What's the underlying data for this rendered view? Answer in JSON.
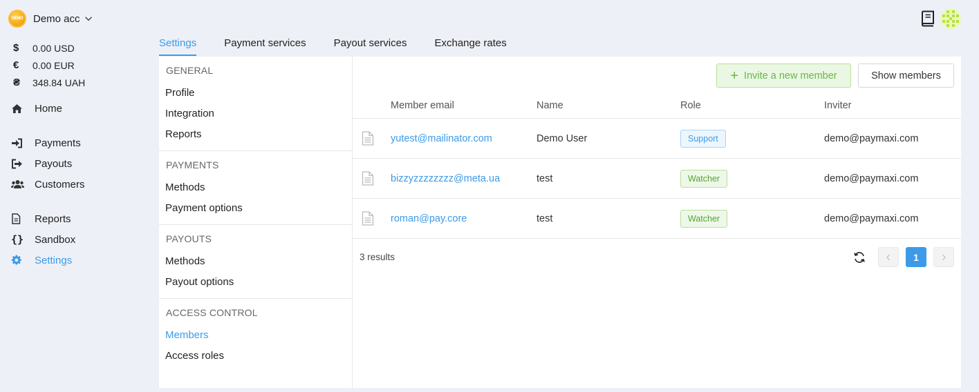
{
  "account": {
    "logo_text": "DEMO",
    "name": "Demo acc"
  },
  "balances": [
    {
      "symbol": "$",
      "amount": "0.00 USD"
    },
    {
      "symbol": "€",
      "amount": "0.00 EUR"
    },
    {
      "symbol": "₴",
      "amount": "348.84 UAH"
    }
  ],
  "nav": {
    "home": "Home",
    "payments": "Payments",
    "payouts": "Payouts",
    "customers": "Customers",
    "reports": "Reports",
    "sandbox": "Sandbox",
    "settings": "Settings"
  },
  "tabs": [
    "Settings",
    "Payment services",
    "Payout services",
    "Exchange rates"
  ],
  "menu": {
    "general": {
      "heading": "GENERAL",
      "items": [
        "Profile",
        "Integration",
        "Reports"
      ]
    },
    "payments": {
      "heading": "PAYMENTS",
      "items": [
        "Methods",
        "Payment options"
      ]
    },
    "payouts": {
      "heading": "PAYOUTS",
      "items": [
        "Methods",
        "Payout options"
      ]
    },
    "access": {
      "heading": "ACCESS CONTROL",
      "items": [
        "Members",
        "Access roles"
      ]
    }
  },
  "buttons": {
    "invite": "Invite a new member",
    "show": "Show members"
  },
  "table": {
    "columns": [
      "Member email",
      "Name",
      "Role",
      "Inviter"
    ],
    "rows": [
      {
        "email": "yutest@mailinator.com",
        "name": "Demo User",
        "role": "Support",
        "inviter": "demo@paymaxi.com"
      },
      {
        "email": "bizzyzzzzzzzz@meta.ua",
        "name": "test",
        "role": "Watcher",
        "inviter": "demo@paymaxi.com"
      },
      {
        "email": "roman@pay.core",
        "name": "test",
        "role": "Watcher",
        "inviter": "demo@paymaxi.com"
      }
    ]
  },
  "footer": {
    "results": "3 results",
    "page": "1"
  },
  "icons": {
    "home": "home-icon",
    "payments": "sign-in-icon",
    "payouts": "sign-out-icon",
    "customers": "users-icon",
    "reports": "file-icon",
    "sandbox": "braces-icon",
    "settings": "gear-icon",
    "book": "book-icon",
    "refresh": "refresh-icon"
  },
  "colors": {
    "accent": "#3d9ae8",
    "success": "#69b64a",
    "background": "#eef0f7"
  }
}
